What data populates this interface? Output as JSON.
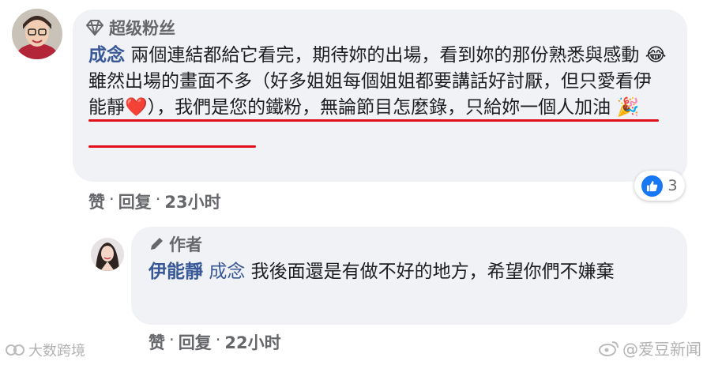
{
  "comment": {
    "badge_label": "超级粉丝",
    "author_name": "成念",
    "body_part1": "兩個連結都給它看完，期待妳的出場，看到妳的那份熟悉與感動",
    "emoji_laugh": "😂",
    "body_part2": "雖然出場的畫面不多（好多姐姐每個姐姐都要講話好討厭，但只愛看伊能靜",
    "emoji_heart": "❤️",
    "body_part3": "），我們是您的鐵粉，無論節目怎麼錄，只給妳一個人加油",
    "emoji_party": "🎉",
    "actions": {
      "like": "赞",
      "reply": "回复",
      "time": "23小时",
      "separator": "·"
    },
    "reaction_count": "3"
  },
  "reply": {
    "badge_label": "作者",
    "author_name": "伊能靜",
    "mention": "成念",
    "body": "我後面還是有做不好的地方，希望你們不嫌棄",
    "actions": {
      "like": "赞",
      "reply": "回复",
      "time": "22小时",
      "separator": "·"
    }
  },
  "watermarks": {
    "left": "大数跨境",
    "right": "@爱豆新闻"
  },
  "colors": {
    "link": "#385898",
    "underline": "#e0101b",
    "bubble": "#f0f2f5",
    "like": "#1877f2"
  }
}
